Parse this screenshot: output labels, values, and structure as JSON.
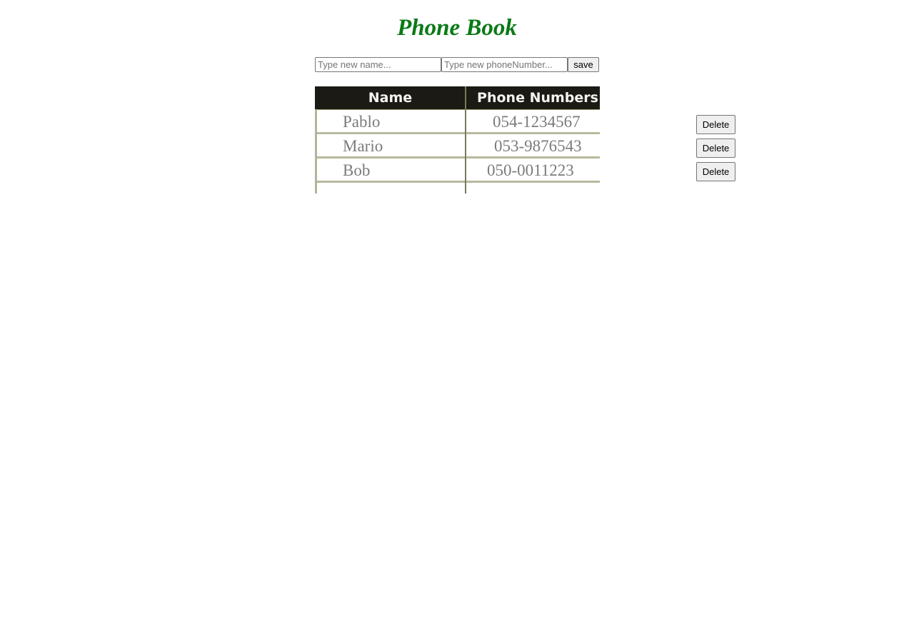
{
  "page": {
    "title": "Phone Book"
  },
  "form": {
    "name_placeholder": "Type new name...",
    "phone_placeholder": "Type new phoneNumber...",
    "save_label": "save"
  },
  "table": {
    "headers": [
      "Name",
      "Phone Numbers"
    ],
    "rows": [
      {
        "name": "Pablo",
        "phone": "054-1234567",
        "delete_label": "Delete"
      },
      {
        "name": "Mario",
        "phone": "053-9876543",
        "delete_label": "Delete"
      },
      {
        "name": "Bob",
        "phone": "050-0011223",
        "delete_label": "Delete"
      }
    ]
  },
  "colors": {
    "title": "#0a7a16",
    "table_header_bg": "#1c1a14",
    "table_header_text": "#f3f3f0",
    "table_cell_text": "#7b7b7b",
    "table_rule": "#b9b99d"
  }
}
